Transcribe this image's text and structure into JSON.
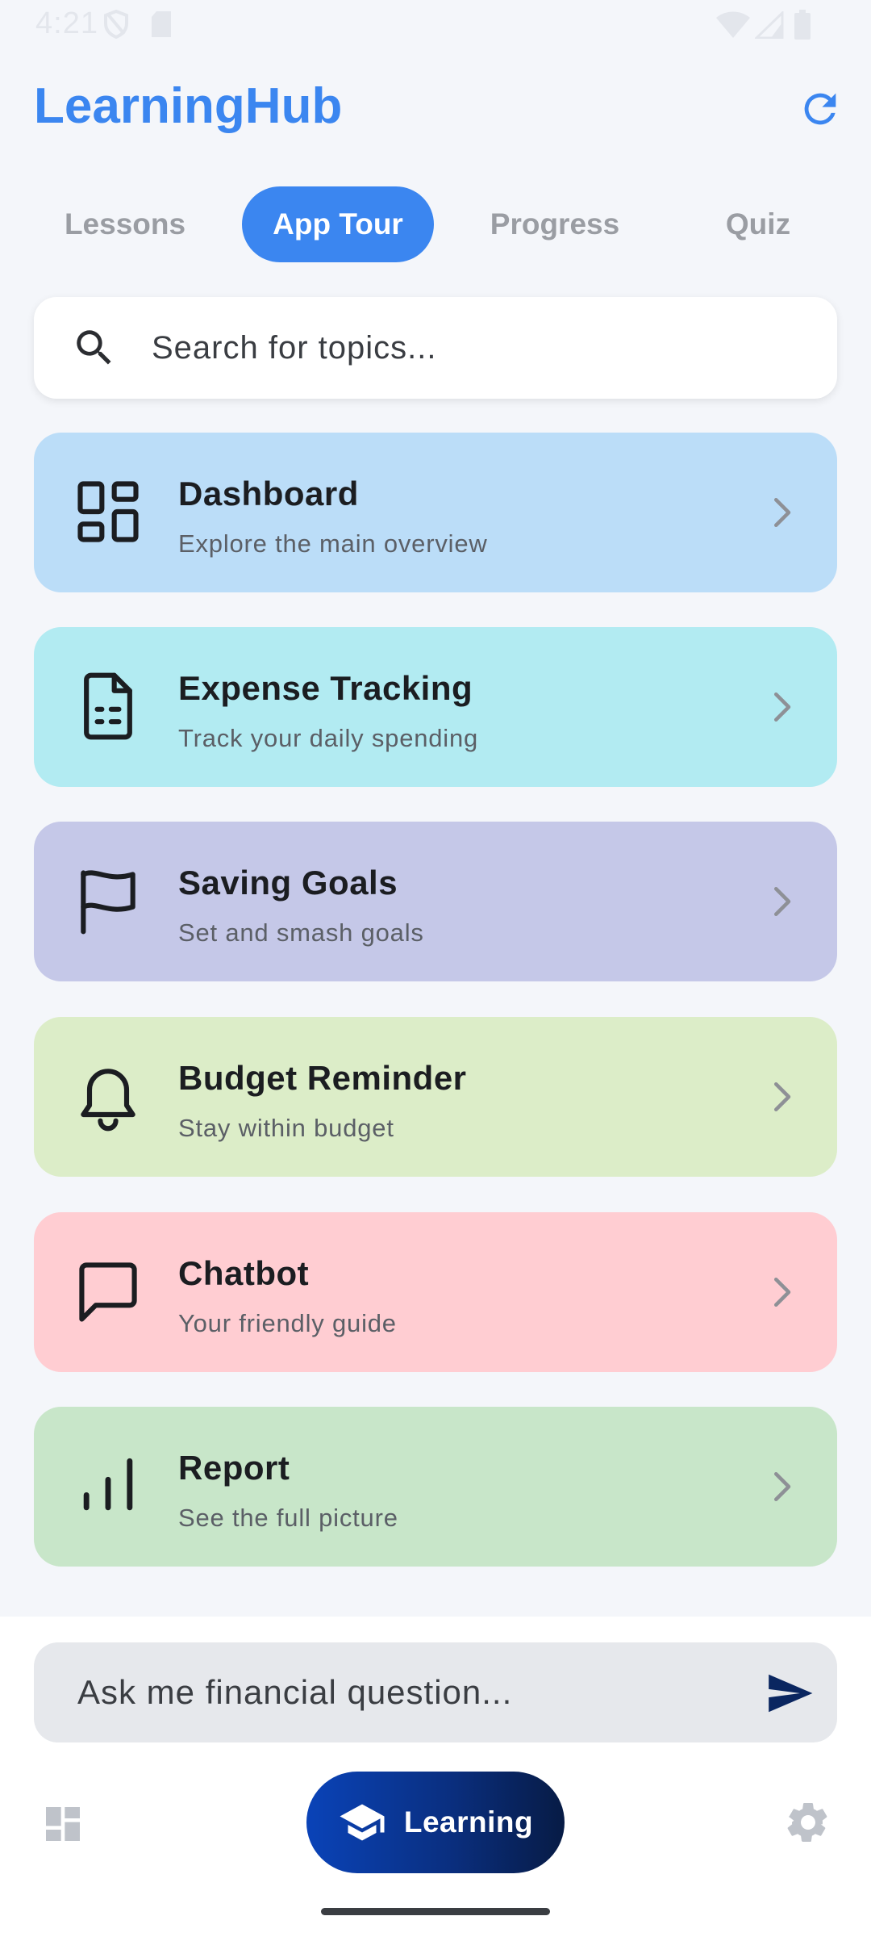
{
  "status_bar": {
    "time": "4:21"
  },
  "app": {
    "title": "LearningHub"
  },
  "tabs": [
    {
      "label": "Lessons",
      "active": false
    },
    {
      "label": "App Tour",
      "active": true
    },
    {
      "label": "Progress",
      "active": false
    },
    {
      "label": "Quiz",
      "active": false
    }
  ],
  "search": {
    "placeholder": "Search for topics..."
  },
  "cards": [
    {
      "title": "Dashboard",
      "subtitle": "Explore the main overview",
      "icon": "dashboard-grid-icon",
      "color": "#BBDDF8"
    },
    {
      "title": "Expense Tracking",
      "subtitle": "Track your daily spending",
      "icon": "document-icon",
      "color": "#B2EBF2"
    },
    {
      "title": "Saving Goals",
      "subtitle": "Set and smash goals",
      "icon": "flag-icon",
      "color": "#C5C8E8"
    },
    {
      "title": "Budget Reminder",
      "subtitle": "Stay within budget",
      "icon": "bell-icon",
      "color": "#DCEDC8"
    },
    {
      "title": "Chatbot",
      "subtitle": "Your friendly guide",
      "icon": "chat-bubble-icon",
      "color": "#FFCDD2"
    },
    {
      "title": "Report",
      "subtitle": "See the full picture",
      "icon": "bar-chart-icon",
      "color": "#C8E6C9"
    }
  ],
  "ask": {
    "placeholder": "Ask me financial question..."
  },
  "bottom_nav": {
    "learning_label": "Learning"
  },
  "colors": {
    "accent": "#3B86F0",
    "background": "#F4F6FA",
    "nav_dark": "#0A2F80"
  }
}
